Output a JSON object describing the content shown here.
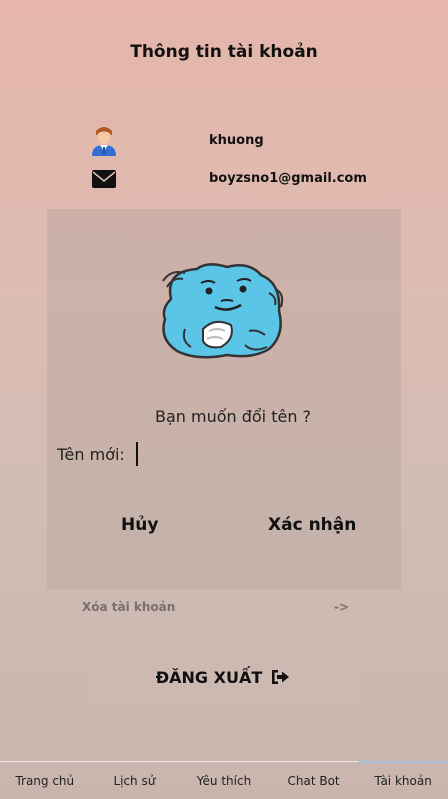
{
  "header": {
    "title": "Thông tin tài khoản"
  },
  "profile": {
    "username": "khuong",
    "email": "boyzsno1@gmail.com",
    "avatar_icon": "user-avatar-icon",
    "email_icon": "envelope-icon"
  },
  "rename_dialog": {
    "prompt": "Bạn muốn đổi tên ?",
    "new_name_label": "Tên mới:",
    "new_name_value": "",
    "cancel_label": "Hủy",
    "confirm_label": "Xác nhận"
  },
  "account": {
    "delete_label": "Xóa tài khoản",
    "delete_arrow": "->",
    "logout_label": "ĐĂNG XUẤT",
    "logout_icon": "sign-out-icon"
  },
  "nav": {
    "items": [
      {
        "label": "Trang chủ"
      },
      {
        "label": "Lịch sử"
      },
      {
        "label": "Yêu thích"
      },
      {
        "label": "Chat Bot"
      },
      {
        "label": "Tài khoản"
      }
    ],
    "active": "Tài khoản"
  },
  "colors": {
    "nav_active_indicator": "#a8c4dc",
    "mascot_blue": "#5bc5e8"
  }
}
